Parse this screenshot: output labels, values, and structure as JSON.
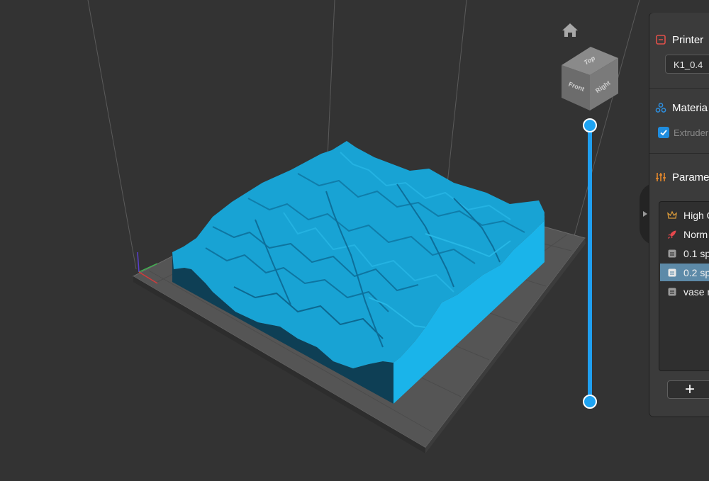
{
  "viewport": {
    "nav_cube": {
      "top": "Top",
      "front": "Front",
      "right": "Right"
    },
    "layer_slider": {
      "top_value": 1.0,
      "bottom_value": 0.0
    }
  },
  "panel": {
    "printer": {
      "title": "Printer",
      "icon": "printer-icon",
      "selected_profile": "K1_0.4"
    },
    "material": {
      "title": "Materia",
      "icon": "material-icon",
      "extruder_label": "Extruder",
      "extruder_checked": true
    },
    "parameters": {
      "title": "Parame",
      "icon": "sliders-icon",
      "profiles": [
        {
          "label": "High Q",
          "icon": "crown-icon",
          "selected": false
        },
        {
          "label": "Norm",
          "icon": "rocket-icon",
          "selected": false
        },
        {
          "label": "0.1 sp",
          "icon": "document-icon",
          "selected": false
        },
        {
          "label": "0.2 sp",
          "icon": "document-icon",
          "selected": true
        },
        {
          "label": "vase m",
          "icon": "document-icon",
          "selected": false
        }
      ],
      "add_label": "+"
    }
  },
  "colors": {
    "background": "#333333",
    "model": "#1aa3d6",
    "accent": "#1f9ff0",
    "selected_row": "#5d8aa8",
    "printer_icon": "#e0504a",
    "material_icon": "#2d8fe0",
    "parameters_icon": "#e6892c"
  }
}
